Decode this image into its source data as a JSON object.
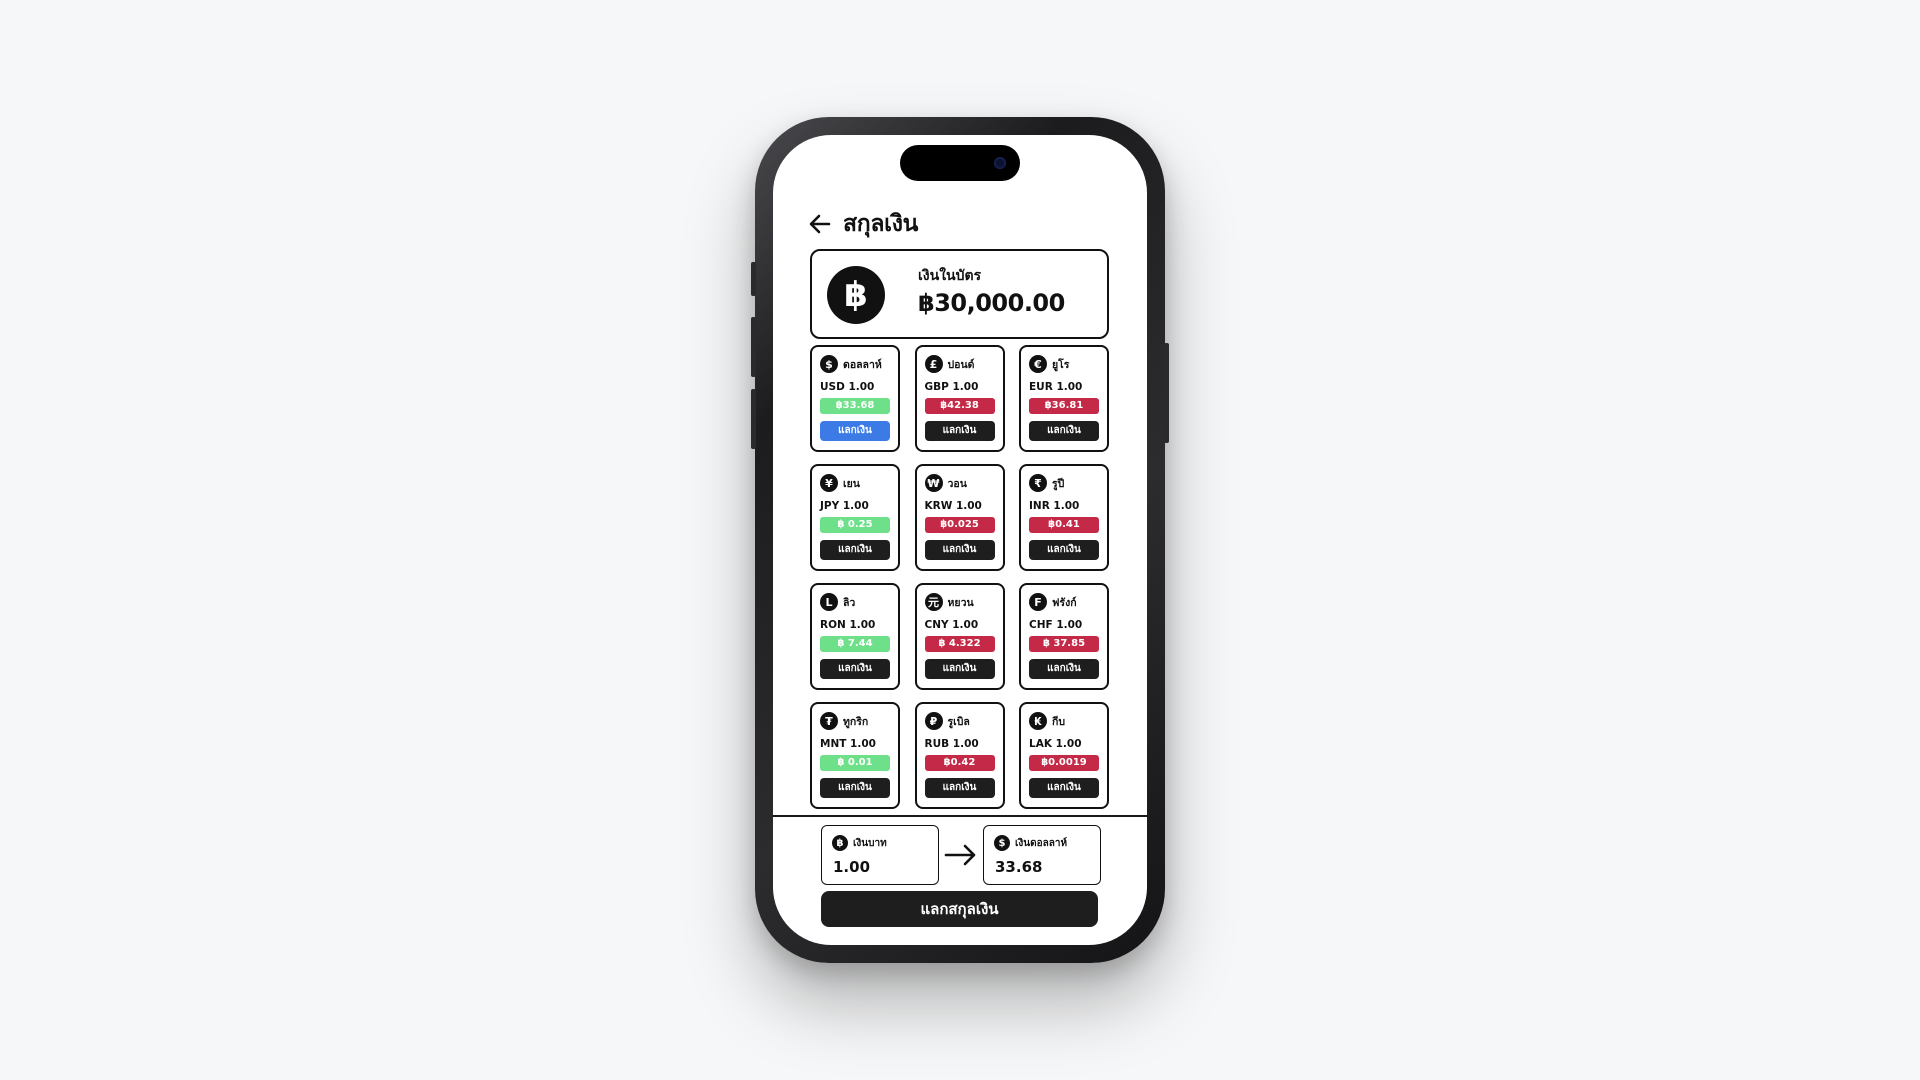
{
  "header": {
    "title": "สกุลเงิน",
    "back_icon": "arrow-left-icon"
  },
  "balance": {
    "icon": "baht-icon",
    "symbol": "฿",
    "label": "เงินในบัตร",
    "value": "฿30,000.00"
  },
  "currencies": [
    {
      "icon": "dollar-icon",
      "symbol": "$",
      "name": "ดอลลาห์",
      "code": "USD 1.00",
      "rate": "฿33.68",
      "rate_color": "#6ee08a",
      "button": "แลกเงิน",
      "button_color": "#3c7be6"
    },
    {
      "icon": "pound-icon",
      "symbol": "£",
      "name": "ปอนด์",
      "code": "GBP 1.00",
      "rate": "฿42.38",
      "rate_color": "#c42a47",
      "button": "แลกเงิน",
      "button_color": "#1e1e1e"
    },
    {
      "icon": "euro-icon",
      "symbol": "€",
      "name": "ยูโร",
      "code": "EUR 1.00",
      "rate": "฿36.81",
      "rate_color": "#c42a47",
      "button": "แลกเงิน",
      "button_color": "#1e1e1e"
    },
    {
      "icon": "yen-icon",
      "symbol": "¥",
      "name": "เยน",
      "code": "JPY 1.00",
      "rate": "฿ 0.25",
      "rate_color": "#6ee08a",
      "button": "แลกเงิน",
      "button_color": "#1e1e1e"
    },
    {
      "icon": "won-icon",
      "symbol": "₩",
      "name": "วอน",
      "code": "KRW 1.00",
      "rate": "฿0.025",
      "rate_color": "#c42a47",
      "button": "แลกเงิน",
      "button_color": "#1e1e1e"
    },
    {
      "icon": "rupee-icon",
      "symbol": "₹",
      "name": "รูปี",
      "code": "INR 1.00",
      "rate": "฿0.41",
      "rate_color": "#c42a47",
      "button": "แลกเงิน",
      "button_color": "#1e1e1e"
    },
    {
      "icon": "leu-icon",
      "symbol": "L",
      "name": "ลิว",
      "code": "RON 1.00",
      "rate": "฿ 7.44",
      "rate_color": "#6ee08a",
      "button": "แลกเงิน",
      "button_color": "#1e1e1e"
    },
    {
      "icon": "yuan-icon",
      "symbol": "元",
      "name": "หยวน",
      "code": "CNY 1.00",
      "rate": "฿ 4.322",
      "rate_color": "#c42a47",
      "button": "แลกเงิน",
      "button_color": "#1e1e1e"
    },
    {
      "icon": "franc-icon",
      "symbol": "F",
      "name": "ฟรังก์",
      "code": "CHF 1.00",
      "rate": "฿ 37.85",
      "rate_color": "#c42a47",
      "button": "แลกเงิน",
      "button_color": "#1e1e1e"
    },
    {
      "icon": "tugrik-icon",
      "symbol": "₮",
      "name": "ทูกริก",
      "code": "MNT 1.00",
      "rate": "฿ 0.01",
      "rate_color": "#6ee08a",
      "button": "แลกเงิน",
      "button_color": "#1e1e1e"
    },
    {
      "icon": "ruble-icon",
      "symbol": "₽",
      "name": "รูเบิล",
      "code": "RUB 1.00",
      "rate": "฿0.42",
      "rate_color": "#c42a47",
      "button": "แลกเงิน",
      "button_color": "#1e1e1e"
    },
    {
      "icon": "kip-icon",
      "symbol": "₭",
      "name": "กีบ",
      "code": "LAK 1.00",
      "rate": "฿0.0019",
      "rate_color": "#c42a47",
      "button": "แลกเงิน",
      "button_color": "#1e1e1e"
    }
  ],
  "converter": {
    "from": {
      "icon": "baht-icon",
      "symbol": "฿",
      "label": "เงินบาท",
      "value": "1.00"
    },
    "arrow_icon": "arrow-right-icon",
    "to": {
      "icon": "dollar-icon",
      "symbol": "$",
      "label": "เงินดอลลาห์",
      "value": "33.68"
    },
    "button": "แลกสกุลเงิน"
  }
}
